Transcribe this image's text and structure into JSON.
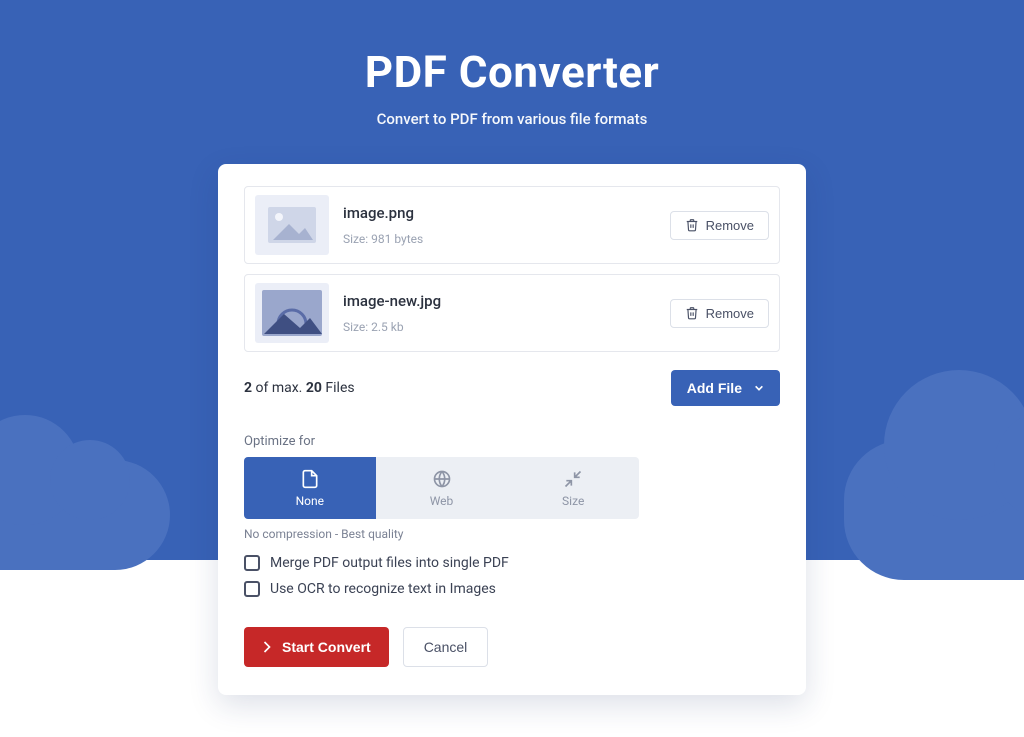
{
  "hero": {
    "title": "PDF Converter",
    "subtitle": "Convert to PDF from various file formats"
  },
  "files": [
    {
      "name": "image.png",
      "size_label": "Size: 981 bytes",
      "remove_label": "Remove"
    },
    {
      "name": "image-new.jpg",
      "size_label": "Size: 2.5 kb",
      "remove_label": "Remove"
    }
  ],
  "file_counter": {
    "count": "2",
    "of_max_text": " of max. ",
    "max": "20",
    "files_text": " Files"
  },
  "add_file_label": "Add File",
  "optimize": {
    "section_label": "Optimize for",
    "tabs": [
      {
        "label": "None",
        "active": true
      },
      {
        "label": "Web",
        "active": false
      },
      {
        "label": "Size",
        "active": false
      }
    ],
    "hint": "No compression - Best quality"
  },
  "options": {
    "merge_label": "Merge PDF output files into single PDF",
    "ocr_label": "Use OCR to recognize text in Images"
  },
  "actions": {
    "start_label": "Start Convert",
    "cancel_label": "Cancel"
  }
}
